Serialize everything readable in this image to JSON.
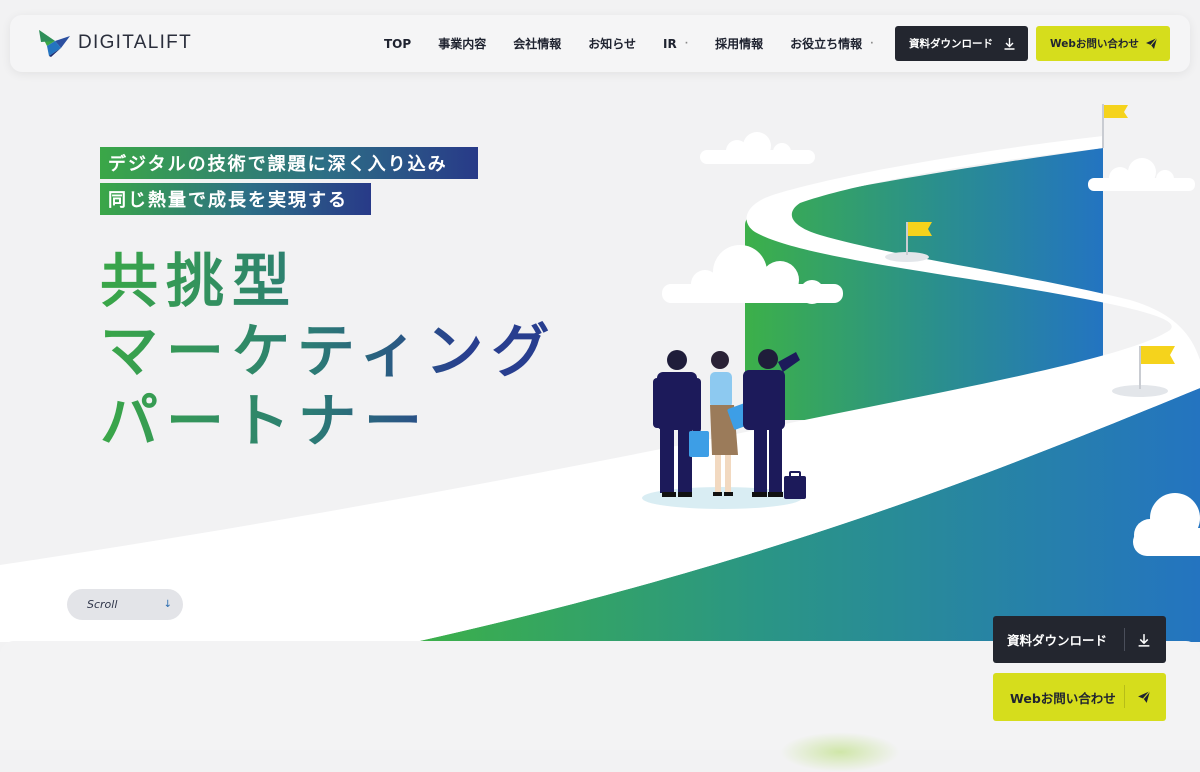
{
  "brand": {
    "name": "DIGITALIFT"
  },
  "nav": [
    {
      "label": "TOP",
      "has_dropdown": false
    },
    {
      "label": "事業内容",
      "has_dropdown": false
    },
    {
      "label": "会社情報",
      "has_dropdown": false
    },
    {
      "label": "お知らせ",
      "has_dropdown": false
    },
    {
      "label": "IR",
      "has_dropdown": true
    },
    {
      "label": "採用情報",
      "has_dropdown": false
    },
    {
      "label": "お役立ち情報",
      "has_dropdown": true
    }
  ],
  "header_buttons": {
    "download": "資料ダウンロード",
    "contact": "Webお問い合わせ"
  },
  "hero": {
    "tag_line1": "デジタルの技術で課題に深く入り込み",
    "tag_line2": "同じ熱量で成長を実現する",
    "headline_line1": "共挑型",
    "headline_line2": "マーケティング",
    "headline_line3": "パートナー"
  },
  "scroll": {
    "label": "Scroll"
  },
  "floating_buttons": {
    "download": "資料ダウンロード",
    "contact": "Webお問い合わせ"
  },
  "icons": {
    "logo": "bird-logo-icon",
    "download": "download-icon",
    "send": "paper-plane-icon",
    "scroll": "arrow-down-icon",
    "dropdown": "dot-icon"
  },
  "colors": {
    "accent_green": "#3aa747",
    "accent_navy": "#283a88",
    "accent_yellow": "#d6dd1c",
    "dark_button": "#23262f",
    "flag_yellow": "#f5d31c",
    "wall_blue": "#2474c0"
  }
}
